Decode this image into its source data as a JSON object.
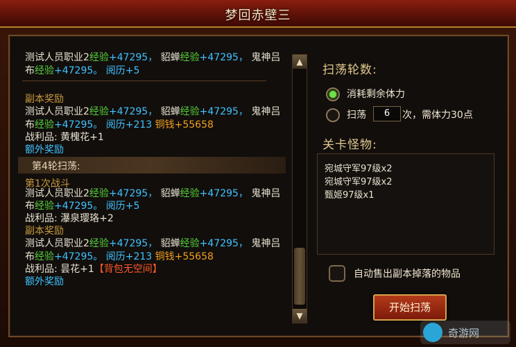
{
  "window": {
    "title": "梦回赤壁三"
  },
  "log": {
    "lines": [
      {
        "segs": [
          {
            "t": "测试人员职业2",
            "c": ""
          },
          {
            "t": "经验",
            "c": "c-green"
          },
          {
            "t": "+47295，",
            "c": "c-cyan"
          },
          {
            "t": " 貂蝉",
            "c": ""
          },
          {
            "t": "经验",
            "c": "c-green"
          },
          {
            "t": "+47295，",
            "c": "c-cyan"
          },
          {
            "t": " 鬼神吕",
            "c": ""
          }
        ]
      },
      {
        "segs": [
          {
            "t": "布",
            "c": ""
          },
          {
            "t": "经验",
            "c": "c-green"
          },
          {
            "t": "+47295。",
            "c": "c-cyan"
          },
          {
            "t": " 阅历",
            "c": "c-cyan"
          },
          {
            "t": "+5",
            "c": "c-cyan"
          }
        ]
      },
      {
        "segs": [
          {
            "t": "副本奖励",
            "c": "c-gold"
          }
        ]
      },
      {
        "segs": [
          {
            "t": "测试人员职业2",
            "c": ""
          },
          {
            "t": "经验",
            "c": "c-green"
          },
          {
            "t": "+47295，",
            "c": "c-cyan"
          },
          {
            "t": " 貂蝉",
            "c": ""
          },
          {
            "t": "经验",
            "c": "c-green"
          },
          {
            "t": "+47295，",
            "c": "c-cyan"
          },
          {
            "t": " 鬼神吕",
            "c": ""
          }
        ]
      },
      {
        "segs": [
          {
            "t": "布",
            "c": ""
          },
          {
            "t": "经验",
            "c": "c-green"
          },
          {
            "t": "+47295。",
            "c": "c-cyan"
          },
          {
            "t": " 阅历",
            "c": "c-cyan"
          },
          {
            "t": "+213",
            "c": "c-cyan"
          },
          {
            "t": "    铜钱",
            "c": "c-orange"
          },
          {
            "t": "+55658",
            "c": "c-orange"
          }
        ]
      },
      {
        "segs": [
          {
            "t": "战利品:     黄槐花",
            "c": ""
          },
          {
            "t": "+1",
            "c": ""
          }
        ]
      },
      {
        "segs": [
          {
            "t": "额外奖励",
            "c": "c-cyan"
          }
        ]
      },
      {
        "segs": [
          {
            "t": "第1次战斗",
            "c": "c-gold"
          }
        ]
      },
      {
        "segs": [
          {
            "t": "测试人员职业2",
            "c": ""
          },
          {
            "t": "经验",
            "c": "c-green"
          },
          {
            "t": "+47295，",
            "c": "c-cyan"
          },
          {
            "t": " 貂蝉",
            "c": ""
          },
          {
            "t": "经验",
            "c": "c-green"
          },
          {
            "t": "+47295，",
            "c": "c-cyan"
          },
          {
            "t": " 鬼神吕",
            "c": ""
          }
        ]
      },
      {
        "segs": [
          {
            "t": "布",
            "c": ""
          },
          {
            "t": "经验",
            "c": "c-green"
          },
          {
            "t": "+47295。",
            "c": "c-cyan"
          },
          {
            "t": " 阅历",
            "c": "c-cyan"
          },
          {
            "t": "+5",
            "c": "c-cyan"
          }
        ]
      },
      {
        "segs": [
          {
            "t": "战利品:     瀑泉璎珞",
            "c": ""
          },
          {
            "t": "+2",
            "c": ""
          }
        ]
      },
      {
        "segs": [
          {
            "t": "副本奖励",
            "c": "c-gold"
          }
        ]
      },
      {
        "segs": [
          {
            "t": "测试人员职业2",
            "c": ""
          },
          {
            "t": "经验",
            "c": "c-green"
          },
          {
            "t": "+47295，",
            "c": "c-cyan"
          },
          {
            "t": " 貂蝉",
            "c": ""
          },
          {
            "t": "经验",
            "c": "c-green"
          },
          {
            "t": "+47295，",
            "c": "c-cyan"
          },
          {
            "t": " 鬼神吕",
            "c": ""
          }
        ]
      },
      {
        "segs": [
          {
            "t": "布",
            "c": ""
          },
          {
            "t": "经验",
            "c": "c-green"
          },
          {
            "t": "+47295。",
            "c": "c-cyan"
          },
          {
            "t": " 阅历",
            "c": "c-cyan"
          },
          {
            "t": "+213",
            "c": "c-cyan"
          },
          {
            "t": "    铜钱",
            "c": "c-orange"
          },
          {
            "t": "+55658",
            "c": "c-orange"
          }
        ]
      },
      {
        "segs": [
          {
            "t": "战利品:     昙花",
            "c": ""
          },
          {
            "t": "+1",
            "c": ""
          },
          {
            "t": "【背包无空间】",
            "c": "c-red"
          }
        ]
      },
      {
        "segs": [
          {
            "t": "额外奖励",
            "c": "c-cyan"
          }
        ]
      }
    ],
    "round_header": "第4轮扫荡:"
  },
  "sweep": {
    "title": "扫荡轮数:",
    "option1": "消耗剩余体力",
    "option2_prefix": "扫荡",
    "count": "6",
    "option2_suffix": "次，需体力30点"
  },
  "monsters": {
    "title": "关卡怪物:",
    "items": [
      "宛城守军97级x2",
      "宛城守军97级x2",
      "甄姬97级x1"
    ]
  },
  "auto_sell": {
    "label": "自动售出副本掉落的物品",
    "checked": false
  },
  "start_button": "开始扫荡",
  "watermark": "奇游网"
}
